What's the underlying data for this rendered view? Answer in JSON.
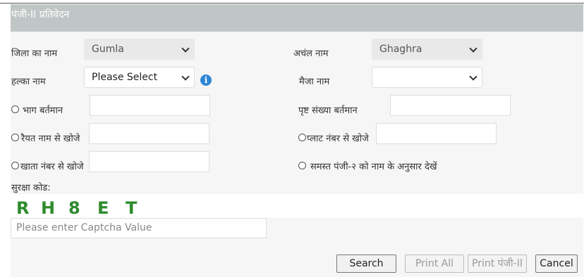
{
  "panel": {
    "title": "पंजी-II प्रतिवेदन"
  },
  "fields": {
    "district_label": "जिला का नाम",
    "district_value": "Gumla",
    "anchal_label": "अचंल नाम",
    "anchal_value": "Ghaghra",
    "halka_label": "हल्का नाम",
    "halka_value": "Please Select",
    "mauza_label": "मैजा नाम",
    "mauza_value": ""
  },
  "search_options": {
    "bhag_label": "भाग बर्तमान",
    "prishth_label": "पृष्ट संख्या बर्तमान",
    "raiyat_label": "रैयत नाम से खोजे",
    "plot_label": "प्लाट नंबर से खोजे",
    "khata_label": "खाता नंबर से खोजे",
    "all_label": "समस्त पंजी-२ को नाम के अनुसार देखें"
  },
  "captcha": {
    "label": "सुरक्षा कोड:",
    "chars": [
      "R",
      "H",
      "8",
      "E",
      "T"
    ],
    "placeholder": "Please enter Captcha Value",
    "color": "#2e8b2e"
  },
  "buttons": {
    "search": "Search",
    "print_all": "Print All",
    "print_panji": "Print पंजी-II",
    "cancel": "Cancel"
  }
}
